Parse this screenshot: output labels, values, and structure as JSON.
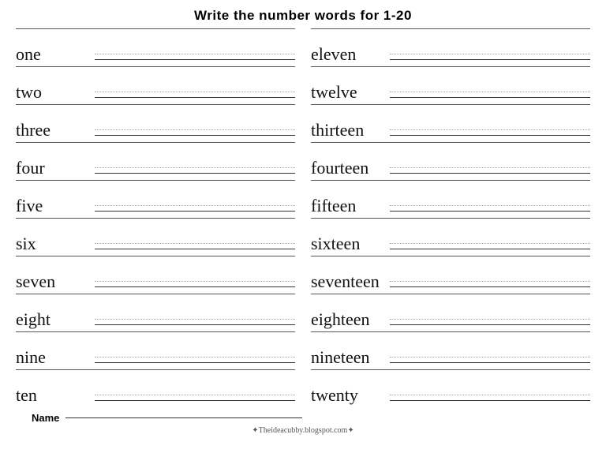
{
  "title": "Write the number words for  1-20",
  "left_column": [
    {
      "word": "one"
    },
    {
      "word": "two"
    },
    {
      "word": "three"
    },
    {
      "word": "four"
    },
    {
      "word": "five"
    },
    {
      "word": "six"
    },
    {
      "word": "seven"
    },
    {
      "word": "eight"
    },
    {
      "word": "nine"
    },
    {
      "word": "ten"
    }
  ],
  "right_column": [
    {
      "word": "eleven"
    },
    {
      "word": "twelve"
    },
    {
      "word": "thirteen"
    },
    {
      "word": "fourteen"
    },
    {
      "word": "fifteen"
    },
    {
      "word": "sixteen"
    },
    {
      "word": "seventeen"
    },
    {
      "word": "eighteen"
    },
    {
      "word": "nineteen"
    },
    {
      "word": "twenty"
    }
  ],
  "footer": {
    "name_label": "Name",
    "url": "✦Theideacubby.blogspot.com✦"
  }
}
